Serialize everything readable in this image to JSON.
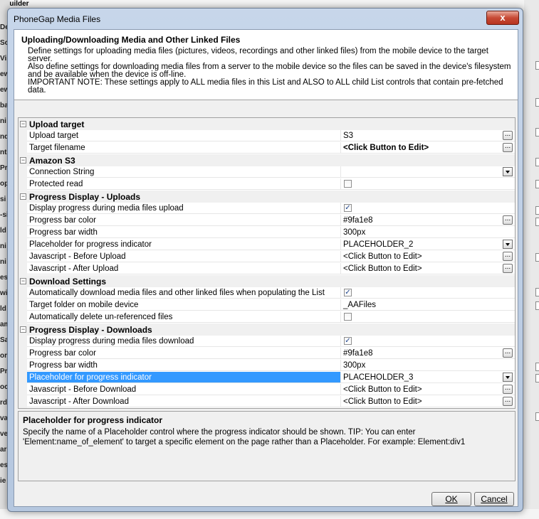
{
  "dialog": {
    "title": "PhoneGap Media Files",
    "close_glyph": "x",
    "header_title": "Uploading/Downloading Media and Other Linked Files",
    "header_lines": [
      "Define settings for uploading media files (pictures, videos, recordings and other linked files) from the mobile device to the target server.",
      "Also define settings for downloading media files from a server to the mobile device so the files can be saved in the device's filesystem and be available when the device is off-line.",
      "IMPORTANT NOTE: These settings apply to ALL media files in this List and ALSO to ALL child List controls that contain pre-fetched data."
    ]
  },
  "background": {
    "top_text": "t Builder",
    "left_fragments": [
      "De",
      "So",
      "Vi",
      "ew",
      "ew",
      "ba",
      "ni",
      "nd",
      "ntr",
      "Pr",
      "op",
      "si",
      "-si",
      "ld",
      "ni",
      "ni",
      "es",
      "wi",
      "ld",
      "am",
      "Sa",
      "or",
      "Pr",
      "oc",
      "rd",
      "va",
      "ve",
      "ar",
      "es",
      "ie"
    ]
  },
  "grid": {
    "rows": [
      {
        "kind": "category",
        "label": "Upload target"
      },
      {
        "kind": "prop",
        "name": "Upload target",
        "value": "S3",
        "editor": "ellipsis"
      },
      {
        "kind": "prop",
        "name": "Target filename",
        "value": "<Click Button to Edit>",
        "editor": "ellipsis",
        "bold": true
      },
      {
        "kind": "category",
        "label": "Amazon S3"
      },
      {
        "kind": "prop",
        "name": "Connection String",
        "value": "",
        "editor": "dropdown"
      },
      {
        "kind": "prop",
        "name": "Protected read",
        "checkbox": false
      },
      {
        "kind": "category",
        "label": "Progress Display - Uploads"
      },
      {
        "kind": "prop",
        "name": "Display progress during media files upload",
        "checkbox": true
      },
      {
        "kind": "prop",
        "name": "Progress bar color",
        "value": "#9fa1e8",
        "editor": "ellipsis"
      },
      {
        "kind": "prop",
        "name": "Progress bar width",
        "value": "300px"
      },
      {
        "kind": "prop",
        "name": "Placeholder for progress indicator",
        "value": "PLACEHOLDER_2",
        "editor": "dropdown"
      },
      {
        "kind": "prop",
        "name": "Javascript - Before Upload",
        "value": "<Click Button to Edit>",
        "editor": "ellipsis"
      },
      {
        "kind": "prop",
        "name": "Javascript - After Upload",
        "value": "<Click Button to Edit>",
        "editor": "ellipsis"
      },
      {
        "kind": "category",
        "label": "Download Settings"
      },
      {
        "kind": "prop",
        "name": "Automatically download media files and other linked files when populating the List",
        "checkbox": true
      },
      {
        "kind": "prop",
        "name": "Target folder on mobile device",
        "value": "_AAFiles"
      },
      {
        "kind": "prop",
        "name": "Automatically delete un-referenced files",
        "checkbox": false
      },
      {
        "kind": "category",
        "label": "Progress Display - Downloads"
      },
      {
        "kind": "prop",
        "name": "Display progress during media files download",
        "checkbox": true
      },
      {
        "kind": "prop",
        "name": "Progress bar color",
        "value": "#9fa1e8",
        "editor": "ellipsis"
      },
      {
        "kind": "prop",
        "name": "Progress bar width",
        "value": "300px"
      },
      {
        "kind": "prop",
        "name": "Placeholder for progress indicator",
        "value": "PLACEHOLDER_3",
        "editor": "dropdown",
        "selected": true
      },
      {
        "kind": "prop",
        "name": "Javascript - Before Download",
        "value": "<Click Button to Edit>",
        "editor": "ellipsis"
      },
      {
        "kind": "prop",
        "name": "Javascript - After Download",
        "value": "<Click Button to Edit>",
        "editor": "ellipsis"
      }
    ],
    "collapse_glyph": "−",
    "ellipsis_glyph": "...",
    "check_glyph": "✓"
  },
  "help": {
    "title": "Placeholder for progress indicator",
    "text": "Specify the name of a Placeholder control where the progress indicator should be shown. TIP: You can enter 'Element:name_of_element' to target a specific element on the page rather than a Placeholder. For example: Element:div1"
  },
  "buttons": {
    "ok_label": "OK",
    "cancel_label": "Cancel"
  },
  "colors": {
    "selection": "#3399ff",
    "close_button": "#c74a35"
  }
}
